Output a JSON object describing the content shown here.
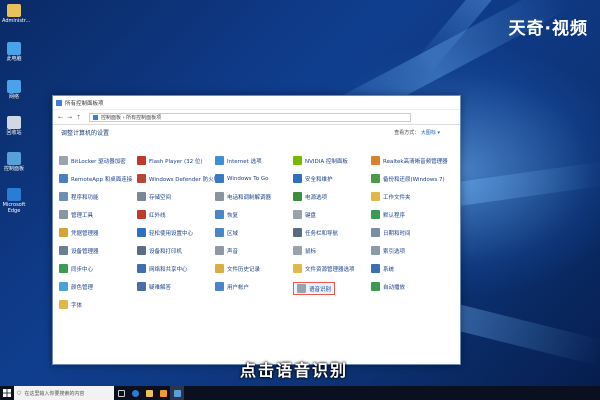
{
  "brand": "天奇·视频",
  "caption": "点击语音识别",
  "desktop_icons": [
    {
      "label": "Administr...",
      "icon": "user-folder-icon",
      "color": "#e8c15a"
    },
    {
      "label": "此电脑",
      "icon": "computer-icon",
      "color": "#4aa3e8"
    },
    {
      "label": "网络",
      "icon": "network-icon",
      "color": "#4aa3e8"
    },
    {
      "label": "回收站",
      "icon": "recycle-bin-icon",
      "color": "#cfd8e4"
    },
    {
      "label": "控制面板",
      "icon": "control-panel-icon",
      "color": "#5aa0d8"
    },
    {
      "label": "Microsoft Edge",
      "icon": "edge-icon",
      "color": "#2b7cd3"
    }
  ],
  "window": {
    "title": "所有控制面板项",
    "breadcrumb": "控制面板 › 所有控制面板项",
    "page_title": "调整计算机的设置",
    "view_by_label": "查看方式：",
    "view_by_value": "大图标 ▾"
  },
  "items": [
    {
      "label": "BitLocker 驱动器加密",
      "icon": "bitlocker-icon",
      "color": "#9aa4ae"
    },
    {
      "label": "Flash Player (32 位)",
      "icon": "flash-icon",
      "color": "#c0392b"
    },
    {
      "label": "Internet 选项",
      "icon": "internet-options-icon",
      "color": "#3d8fd8"
    },
    {
      "label": "NVIDIA 控制面板",
      "icon": "nvidia-icon",
      "color": "#76b900"
    },
    {
      "label": "Realtek高清晰音频管理器",
      "icon": "realtek-audio-icon",
      "color": "#d9822b"
    },
    {
      "label": "RemoteApp 和桌面连接",
      "icon": "remoteapp-icon",
      "color": "#4a7fc1"
    },
    {
      "label": "Windows Defender 防火墙",
      "icon": "firewall-icon",
      "color": "#b5473a"
    },
    {
      "label": "Windows To Go",
      "icon": "windows-to-go-icon",
      "color": "#3a78c2"
    },
    {
      "label": "安全和维护",
      "icon": "security-flag-icon",
      "color": "#2f6fc0"
    },
    {
      "label": "备份和还原(Windows 7)",
      "icon": "backup-icon",
      "color": "#4a9a4a"
    },
    {
      "label": "程序和功能",
      "icon": "programs-icon",
      "color": "#6d8fb3"
    },
    {
      "label": "存储空间",
      "icon": "storage-spaces-icon",
      "color": "#7a8896"
    },
    {
      "label": "电话和调制解调器",
      "icon": "phone-modem-icon",
      "color": "#8a949e"
    },
    {
      "label": "电源选项",
      "icon": "power-options-icon",
      "color": "#3d8f3d"
    },
    {
      "label": "工作文件夹",
      "icon": "work-folders-icon",
      "color": "#e0b84a"
    },
    {
      "label": "管理工具",
      "icon": "admin-tools-icon",
      "color": "#8796a5"
    },
    {
      "label": "红外线",
      "icon": "infrared-icon",
      "color": "#c0392b"
    },
    {
      "label": "恢复",
      "icon": "recovery-icon",
      "color": "#4a86c8"
    },
    {
      "label": "键盘",
      "icon": "keyboard-icon",
      "color": "#9aa3ab"
    },
    {
      "label": "默认程序",
      "icon": "default-programs-icon",
      "color": "#3c9a52"
    },
    {
      "label": "凭据管理器",
      "icon": "credential-manager-icon",
      "color": "#d8a23a"
    },
    {
      "label": "轻松使用设置中心",
      "icon": "ease-of-access-icon",
      "color": "#2f6fc0"
    },
    {
      "label": "区域",
      "icon": "region-icon",
      "color": "#4a86c8"
    },
    {
      "label": "任务栏和导航",
      "icon": "taskbar-icon",
      "color": "#5a6b7d"
    },
    {
      "label": "日期和时间",
      "icon": "date-time-icon",
      "color": "#7b8ea3"
    },
    {
      "label": "设备管理器",
      "icon": "device-manager-icon",
      "color": "#6b7f94"
    },
    {
      "label": "设备和打印机",
      "icon": "devices-printers-icon",
      "color": "#5b6d80"
    },
    {
      "label": "声音",
      "icon": "sound-icon",
      "color": "#8d98a3"
    },
    {
      "label": "鼠标",
      "icon": "mouse-icon",
      "color": "#9aa3ab"
    },
    {
      "label": "索引选项",
      "icon": "indexing-icon",
      "color": "#8c9aa8"
    },
    {
      "label": "同步中心",
      "icon": "sync-center-icon",
      "color": "#3c9a52"
    },
    {
      "label": "网络和共享中心",
      "icon": "network-sharing-icon",
      "color": "#3d6fb0"
    },
    {
      "label": "文件历史记录",
      "icon": "file-history-icon",
      "color": "#d8b040"
    },
    {
      "label": "文件资源管理器选项",
      "icon": "explorer-options-icon",
      "color": "#e0b84a"
    },
    {
      "label": "系统",
      "icon": "system-icon",
      "color": "#3d6fb0"
    },
    {
      "label": "颜色管理",
      "icon": "color-management-icon",
      "color": "#4aa3d8"
    },
    {
      "label": "疑难解答",
      "icon": "troubleshooting-icon",
      "color": "#4a6fa8"
    },
    {
      "label": "用户帐户",
      "icon": "user-accounts-icon",
      "color": "#4a86c8"
    },
    {
      "label": "语音识别",
      "icon": "microphone-icon",
      "color": "#9aa3ab",
      "highlight": true
    },
    {
      "label": "自动播放",
      "icon": "autoplay-icon",
      "color": "#3c9a52"
    },
    {
      "label": "字体",
      "icon": "fonts-icon",
      "color": "#e0b84a"
    }
  ],
  "taskbar": {
    "search_placeholder": "在这里输入你要搜索的内容"
  }
}
